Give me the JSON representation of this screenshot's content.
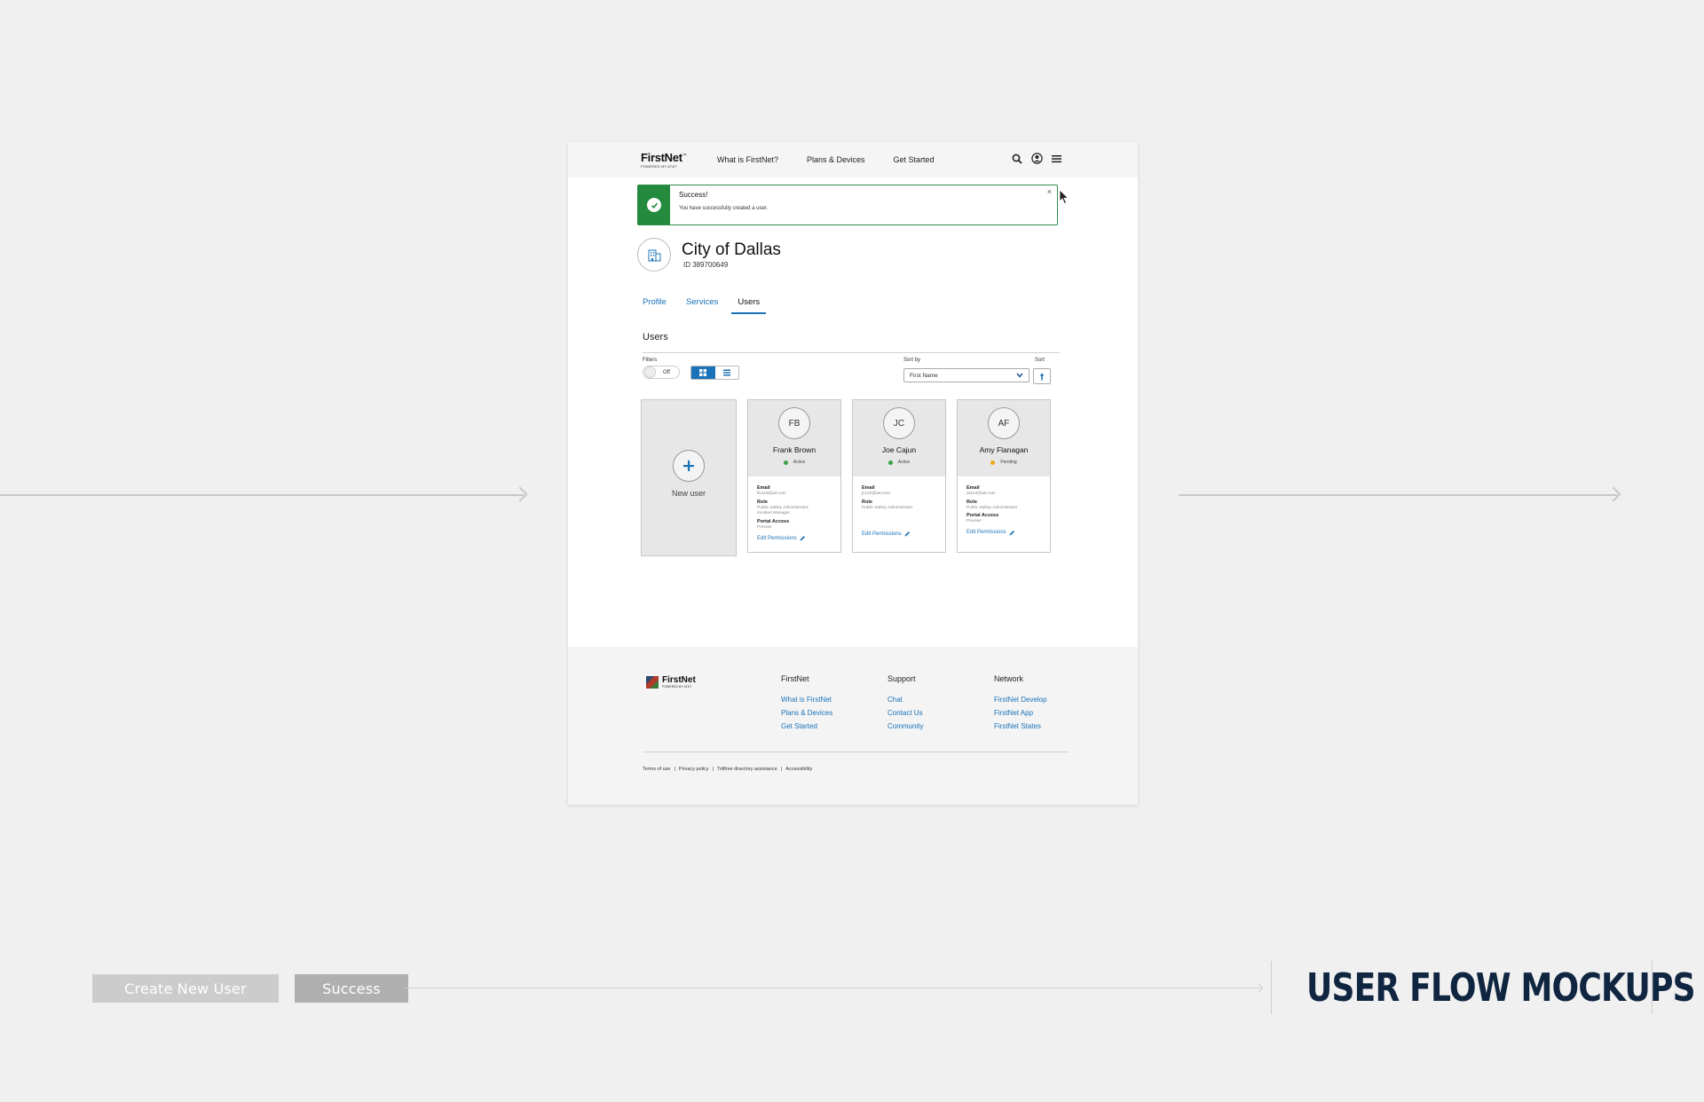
{
  "header": {
    "logo_brand": "FirstNet",
    "logo_tm": "™",
    "logo_powered": "POWERED BY AT&T",
    "nav": [
      "What is FirstNet?",
      "Plans & Devices",
      "Get Started"
    ]
  },
  "alert": {
    "title": "Success!",
    "message": "You have successfully created a user.",
    "close": "×"
  },
  "org": {
    "name": "City of Dallas",
    "id": "ID 389700649"
  },
  "tabs": [
    "Profile",
    "Services",
    "Users"
  ],
  "users_section": {
    "title": "Users",
    "filters_label": "Filters",
    "toggle_text": "Off",
    "sort_by_label": "Sort by",
    "sort_label": "Sort",
    "sort_value": "First Name",
    "new_user_label": "New user"
  },
  "cards": [
    {
      "initials": "FB",
      "name": "Frank Brown",
      "status": "Active",
      "status_color": "#3aa04a",
      "email_label": "Email",
      "email": "fb123@att.com",
      "role_label": "Role",
      "role": "Public Safety Administrator,",
      "role2": "Incident Manager",
      "access_label": "Portal Access",
      "access": "Premier",
      "edit": "Edit Permissions"
    },
    {
      "initials": "JC",
      "name": "Joe Cajun",
      "status": "Active",
      "status_color": "#3aa04a",
      "email_label": "Email",
      "email": "jc123@att.com",
      "role_label": "Role",
      "role": "Public Safety Administrator",
      "edit": "Edit Permissions"
    },
    {
      "initials": "AF",
      "name": "Amy Flanagan",
      "status": "Pending",
      "status_color": "#f0a81c",
      "email_label": "Email",
      "email": "af123@att.com",
      "role_label": "Role",
      "role": "Public Safety Administrator",
      "access_label": "Portal Access",
      "access": "Premier",
      "edit": "Edit Permissions"
    }
  ],
  "footer": {
    "logo_brand": "FirstNet",
    "logo_powered": "POWERED BY AT&T",
    "columns": [
      {
        "heading": "FirstNet",
        "links": [
          "What is FirstNet",
          "Plans & Devices",
          "Get Started"
        ]
      },
      {
        "heading": "Support",
        "links": [
          "Chat",
          "Contact Us",
          "Community"
        ]
      },
      {
        "heading": "Network",
        "links": [
          "FirstNet Develop",
          "FirstNet App",
          "FirstNet States"
        ]
      }
    ],
    "legal": [
      "Terms of use",
      "|",
      "Privacy policy",
      "|",
      "Tollfree directory assistance",
      "|",
      "Accessibility"
    ]
  },
  "flow": {
    "steps": [
      "Create New User",
      "Success"
    ],
    "heading": "USER FLOW MOCKUPS"
  },
  "colors": {
    "accent": "#1a73b8",
    "success": "#238a3e",
    "heading": "#0f2540"
  }
}
